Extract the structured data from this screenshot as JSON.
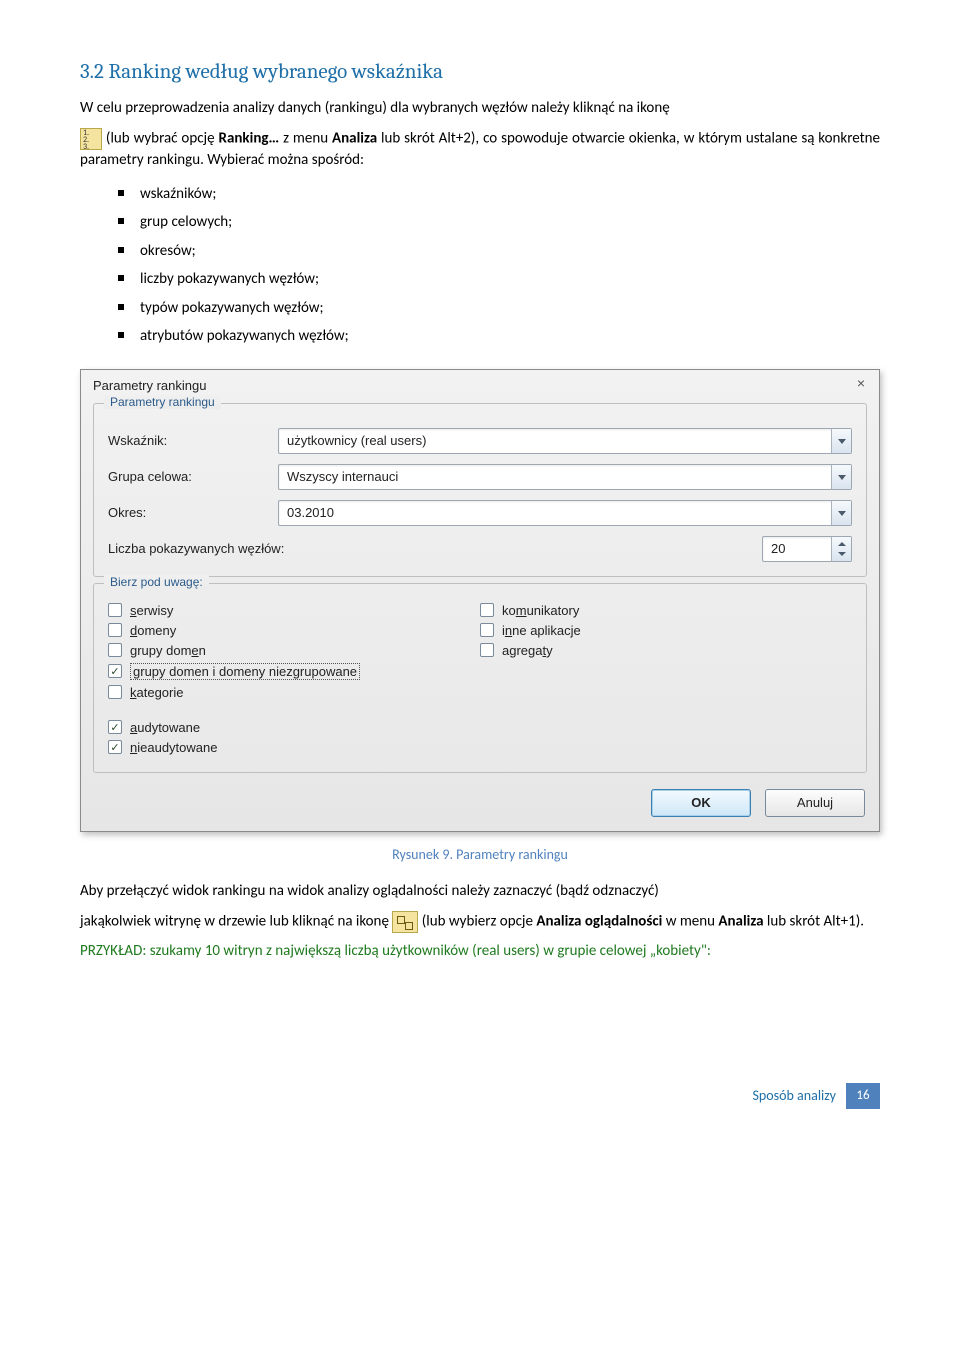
{
  "heading": "3.2  Ranking według wybranego wskaźnika",
  "intro1": "W celu przeprowadzenia analizy danych (rankingu) dla wybranych węzłów należy kliknąć na ikonę",
  "intro2a": "(lub wybrać opcję ",
  "intro2_bold1": "Ranking…",
  "intro2b": " z menu ",
  "intro2_bold2": "Analiza",
  "intro2c": " lub skrót Alt+2), co spowoduje otwarcie okienka, w którym ustalane są konkretne parametry rankingu. Wybierać można spośród:",
  "bullets": [
    "wskaźników;",
    "grup celowych;",
    "okresów;",
    "liczby pokazywanych węzłów;",
    "typów pokazywanych węzłów;",
    "atrybutów pokazywanych węzłów;"
  ],
  "dialog": {
    "title": "Parametry rankingu",
    "legend1": "Parametry rankingu",
    "rows": {
      "wskaznik_label": "Wskaźnik:",
      "wskaznik_value": "użytkownicy (real users)",
      "grupa_label": "Grupa celowa:",
      "grupa_value": "Wszyscy internauci",
      "okres_label": "Okres:",
      "okres_value": "03.2010",
      "liczba_label": "Liczba pokazywanych węzłów:",
      "liczba_value": "20"
    },
    "legend2": "Bierz pod uwagę:",
    "checks_left": [
      {
        "label_pre": "",
        "u": "s",
        "label_post": "erwisy",
        "checked": false,
        "selected": false
      },
      {
        "label_pre": "",
        "u": "d",
        "label_post": "omeny",
        "checked": false,
        "selected": false
      },
      {
        "label_pre": "grupy dom",
        "u": "e",
        "label_post": "n",
        "checked": false,
        "selected": false
      },
      {
        "label_pre": "",
        "u": "g",
        "label_post": "rupy domen i domeny niezgrupowane",
        "checked": true,
        "selected": true
      },
      {
        "label_pre": "",
        "u": "k",
        "label_post": "ategorie",
        "checked": false,
        "selected": false
      }
    ],
    "checks_right": [
      {
        "label_pre": "ko",
        "u": "m",
        "label_post": "unikatory",
        "checked": false
      },
      {
        "label_pre": "i",
        "u": "n",
        "label_post": "ne aplikacje",
        "checked": false
      },
      {
        "label_pre": "agrega",
        "u": "t",
        "label_post": "y",
        "checked": false
      }
    ],
    "checks_bottom": [
      {
        "label_pre": "",
        "u": "a",
        "label_post": "udytowane",
        "checked": true
      },
      {
        "label_pre": "",
        "u": "n",
        "label_post": "ieaudytowane",
        "checked": true
      }
    ],
    "ok": "OK",
    "cancel": "Anuluj"
  },
  "caption": "Rysunek 9. Parametry rankingu",
  "post1": "Aby przełączyć widok rankingu na widok analizy oglądalności należy zaznaczyć (bądź odznaczyć)",
  "post2a": "jakąkolwiek witrynę w drzewie lub kliknąć na ikonę ",
  "post2b": " (lub wybierz opcje ",
  "post2_bold1": "Analiza oglądalności",
  "post2c": " w menu ",
  "post2_bold2": "Analiza",
  "post2d": " lub skrót Alt+1).",
  "example": "PRZYKŁAD: szukamy 10 witryn z największą liczbą użytkowników (real users) w grupie celowej „kobiety\":",
  "footer_text": "Sposób analizy",
  "footer_page": "16"
}
